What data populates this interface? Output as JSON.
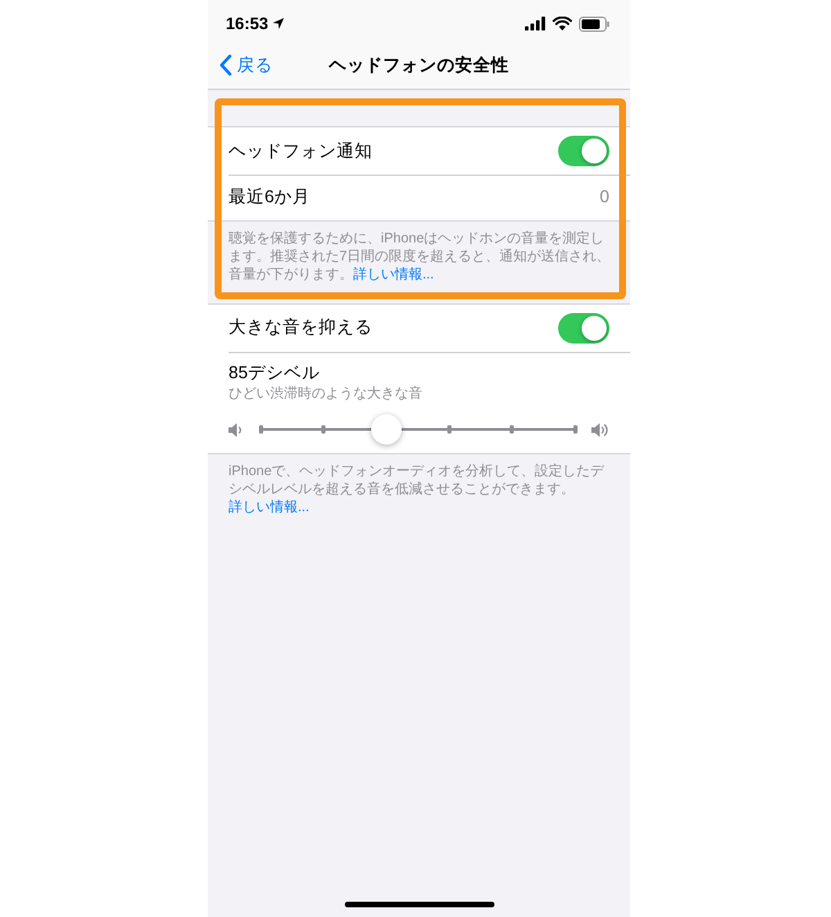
{
  "status_bar": {
    "time": "16:53"
  },
  "nav_bar": {
    "back": "戻る",
    "title": "ヘッドフォンの安全性"
  },
  "groups": [
    {
      "highlighted": true,
      "rows": [
        {
          "kind": "toggle",
          "label": "ヘッドフォン通知",
          "on": true
        },
        {
          "kind": "value",
          "label": "最近6か月",
          "value": "0"
        }
      ],
      "footer": {
        "text": "聴覚を保護するために、iPhoneはヘッドホンの音量を測定します。推奨された7日間の限度を超えると、通知が送信され、音量が下がります。",
        "link": "詳しい情報..."
      }
    },
    {
      "highlighted": false,
      "rows": [
        {
          "kind": "toggle",
          "label": "大きな音を抑える",
          "on": true
        },
        {
          "kind": "slider",
          "label": "85デシベル",
          "subtitle": "ひどい渋滞時のような大きな音",
          "level": 0.4
        }
      ],
      "footer": {
        "text": "iPhoneで、ヘッドフォンオーディオを分析して、設定したデシベルレベルを超える音を低減させることができます。",
        "link": "詳しい情報..."
      }
    }
  ]
}
